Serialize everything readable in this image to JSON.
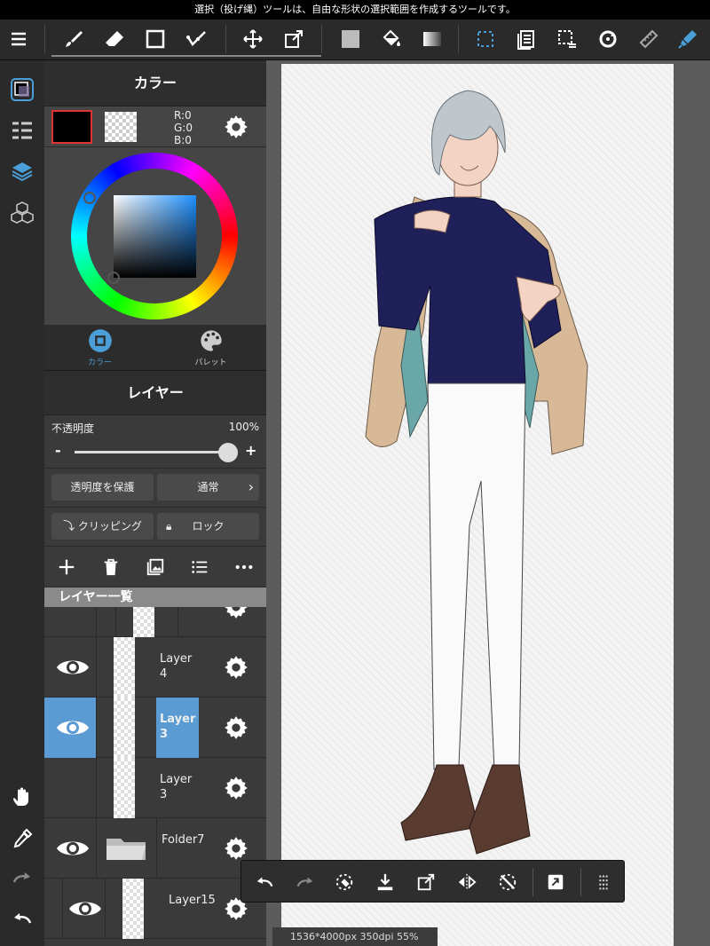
{
  "status_bar": {
    "message": "選択（投げ縄）ツールは、自由な形状の選択範囲を作成するツールです。"
  },
  "toolbar": {
    "tools": [
      {
        "name": "brush-tool",
        "icon": "brush-icon"
      },
      {
        "name": "eraser-tool",
        "icon": "eraser-icon"
      },
      {
        "name": "shape-tool",
        "icon": "square-icon"
      },
      {
        "name": "dot-tool",
        "icon": "dot-brush-icon"
      },
      {
        "name": "move-tool",
        "icon": "move-icon"
      },
      {
        "name": "transform-tool",
        "icon": "transform-icon"
      },
      {
        "name": "fill-color",
        "icon": "fill-swatch-icon"
      },
      {
        "name": "bucket-tool",
        "icon": "bucket-icon"
      },
      {
        "name": "gradient-tool",
        "icon": "gradient-icon"
      },
      {
        "name": "select-tool",
        "icon": "selection-icon"
      },
      {
        "name": "copy-tool",
        "icon": "copy-pages-icon"
      },
      {
        "name": "select-pen-tool",
        "icon": "select-pen-icon"
      },
      {
        "name": "rotate-canvas-tool",
        "icon": "rotate-icon"
      },
      {
        "name": "ruler-tool",
        "icon": "ruler-icon"
      },
      {
        "name": "pen-tool",
        "icon": "pen-icon"
      }
    ],
    "accent": "#4a9fd8"
  },
  "color_panel": {
    "title": "カラー",
    "rgb": {
      "r": "R:0",
      "g": "G:0",
      "b": "B:0"
    },
    "primary_color": "#000000",
    "tab_color": "カラー",
    "tab_palette": "パレット"
  },
  "layer_panel": {
    "title": "レイヤー",
    "opacity_label": "不透明度",
    "opacity_value": "100%",
    "opacity_fraction": 1.0,
    "minus": "-",
    "plus": "+",
    "protect_alpha": "透明度を保護",
    "blend_mode": "通常",
    "clipping": "クリッピング",
    "lock": "ロック",
    "list_header": "レイヤー一覧",
    "layers": [
      {
        "name": "Layer 4",
        "visible": true,
        "selected": false
      },
      {
        "name": "Layer 3",
        "visible": true,
        "selected": true
      },
      {
        "name": "Layer 3",
        "visible": false,
        "selected": false
      },
      {
        "name": "Folder7",
        "visible": true,
        "selected": false
      },
      {
        "name": "Layer15",
        "visible": true,
        "selected": false
      }
    ]
  },
  "canvas": {
    "info": "1536*4000px 350dpi 55%"
  }
}
